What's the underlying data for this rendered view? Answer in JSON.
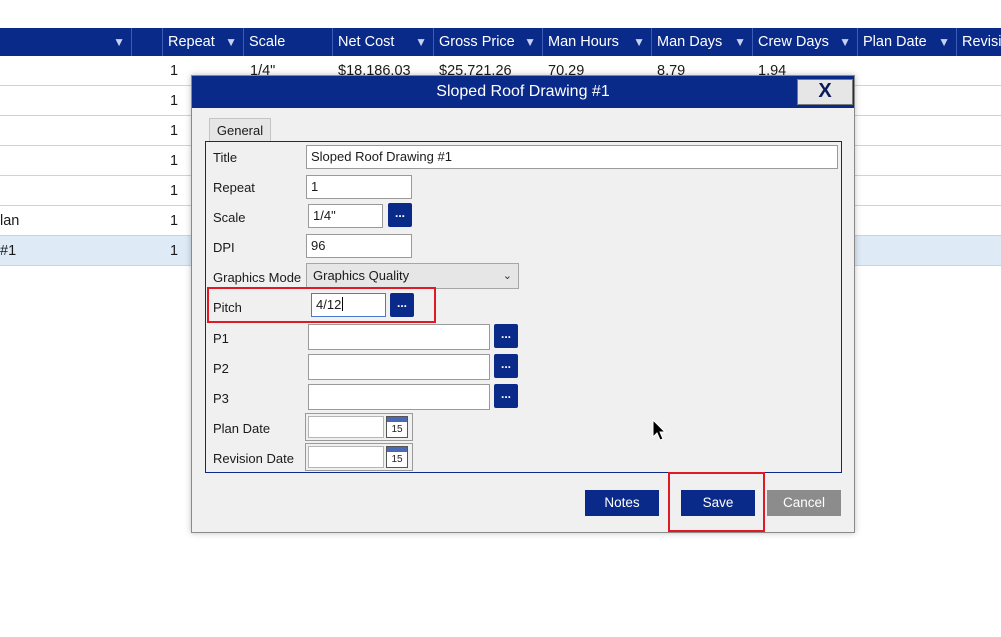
{
  "grid": {
    "headers": [
      {
        "label": "",
        "filter": true
      },
      {
        "label": "",
        "filter": false
      },
      {
        "label": "Repeat",
        "filter": true
      },
      {
        "label": "Scale",
        "filter": false
      },
      {
        "label": "Net Cost",
        "filter": true
      },
      {
        "label": "Gross Price",
        "filter": true
      },
      {
        "label": "Man Hours",
        "filter": true
      },
      {
        "label": "Man Days",
        "filter": true
      },
      {
        "label": "Crew Days",
        "filter": true
      },
      {
        "label": "Plan Date",
        "filter": true
      },
      {
        "label": "Revisi",
        "filter": false
      }
    ],
    "filter_icon": "▼",
    "rows": [
      {
        "name": "",
        "repeat": "1",
        "scale": "1/4\"",
        "net_cost": "$18,186.03",
        "gross_price": "$25,721.26",
        "man_hours": "70.29",
        "man_days": "8.79",
        "crew_days": "1.94"
      },
      {
        "name": "",
        "repeat": "1"
      },
      {
        "name": "",
        "repeat": "1"
      },
      {
        "name": "",
        "repeat": "1"
      },
      {
        "name": "",
        "repeat": "1"
      },
      {
        "name": "lan",
        "repeat": "1"
      },
      {
        "name": "#1",
        "repeat": "1",
        "selected": true
      }
    ]
  },
  "dialog": {
    "title": "Sloped Roof Drawing #1",
    "close_label": "X",
    "tab_label": "General",
    "fields": {
      "title_label": "Title",
      "title_value": "Sloped Roof Drawing #1",
      "repeat_label": "Repeat",
      "repeat_value": "1",
      "scale_label": "Scale",
      "scale_value": "1/4\"",
      "dpi_label": "DPI",
      "dpi_value": "96",
      "graphics_mode_label": "Graphics Mode",
      "graphics_mode_value": "Graphics Quality",
      "pitch_label": "Pitch",
      "pitch_value": "4/12",
      "p1_label": "P1",
      "p2_label": "P2",
      "p3_label": "P3",
      "plan_date_label": "Plan Date",
      "revision_date_label": "Revision Date"
    },
    "ellipsis_label": "...",
    "calendar_day": "15",
    "buttons": {
      "notes": "Notes",
      "save": "Save",
      "cancel": "Cancel"
    }
  },
  "colors": {
    "accent": "#0a2a8a",
    "highlight": "#e01a24",
    "selected_row": "#deeaf6"
  }
}
